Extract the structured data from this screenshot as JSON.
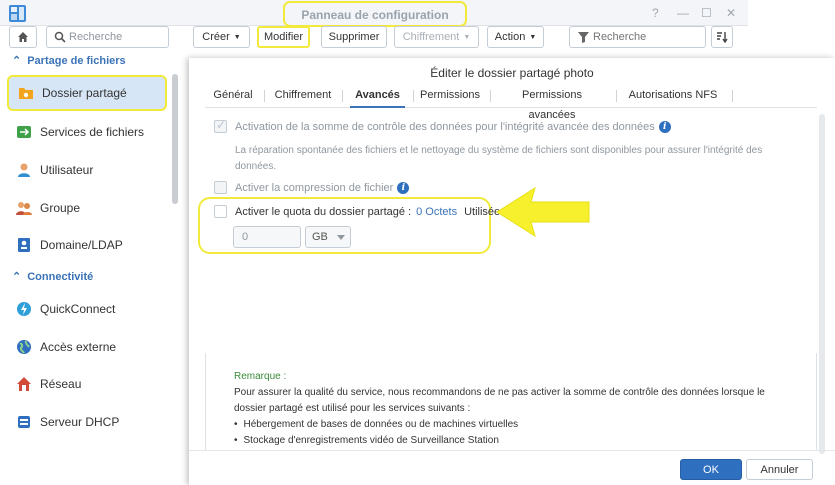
{
  "window": {
    "title": "Panneau de configuration",
    "controls": [
      "?",
      "—",
      "☐",
      "✕"
    ]
  },
  "sidebar": {
    "search_placeholder": "Recherche",
    "sections": [
      {
        "label": "Partage de fichiers"
      },
      {
        "label": "Connectivité"
      }
    ],
    "items": [
      {
        "label": "Dossier partagé"
      },
      {
        "label": "Services de fichiers"
      },
      {
        "label": "Utilisateur"
      },
      {
        "label": "Groupe"
      },
      {
        "label": "Domaine/LDAP"
      },
      {
        "label": "QuickConnect"
      },
      {
        "label": "Accès externe"
      },
      {
        "label": "Réseau"
      },
      {
        "label": "Serveur DHCP"
      }
    ]
  },
  "toolbar": {
    "create": "Créer",
    "edit": "Modifier",
    "delete": "Supprimer",
    "encryption": "Chiffrement",
    "action": "Action",
    "search_placeholder": "Recherche"
  },
  "dialog": {
    "title": "Éditer le dossier partagé photo",
    "tabs": [
      "Général",
      "Chiffrement",
      "Avancés",
      "Permissions",
      "Permissions avancées",
      "Autorisations NFS"
    ],
    "checksum_label": "Activation de la somme de contrôle des données pour l'intégrité avancée des données",
    "checksum_desc": "La réparation spontanée des fichiers et le nettoyage du système de fichiers sont disponibles pour assurer l'intégrité des données.",
    "compression_label": "Activer la compression de fichier",
    "quota_label": "Activer le quota du dossier partagé :",
    "quota_used_value": "0 Octets",
    "quota_used_label": "Utilisée",
    "quota_value": "0",
    "quota_unit": "GB",
    "remark_title": "Remarque :",
    "remark_text": "Pour assurer la qualité du service, nous recommandons de ne pas activer la somme de contrôle des données lorsque le dossier partagé est utilisé pour les services suivants :",
    "remark_items": [
      "Hébergement de bases de données ou de machines virtuelles",
      "Stockage d'enregistrements vidéo de Surveillance Station"
    ],
    "ok": "OK",
    "cancel": "Annuler"
  },
  "colors": {
    "accent": "#2f6fbf",
    "highlight": "#f2ea3a",
    "section": "#3b73b7"
  }
}
